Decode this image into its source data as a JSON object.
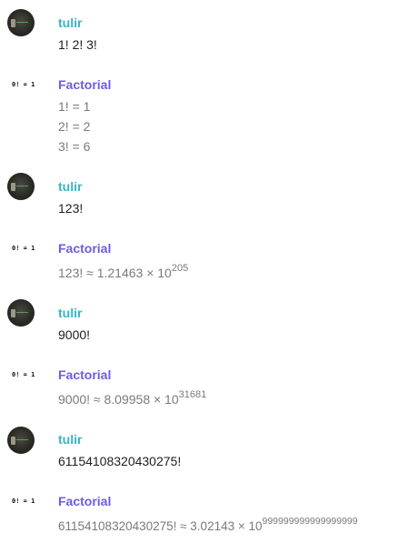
{
  "users": {
    "user": "tulir",
    "bot": "Factorial"
  },
  "bot_avatar_text": "0! = 1",
  "messages": [
    {
      "author": "tulir",
      "text": "1! 2! 3!"
    },
    {
      "author": "Factorial",
      "lines": [
        "1! = 1",
        "2! = 2",
        "3! = 6"
      ]
    },
    {
      "author": "tulir",
      "text": "123!"
    },
    {
      "author": "Factorial",
      "base": "123! ≈ 1.21463 × 10",
      "exp": "205"
    },
    {
      "author": "tulir",
      "text": "9000!"
    },
    {
      "author": "Factorial",
      "base": "9000! ≈ 8.09958 × 10",
      "exp": "31681"
    },
    {
      "author": "tulir",
      "text": "61154108320430275!"
    },
    {
      "author": "Factorial",
      "base": "61154108320430275! ≈ 3.02143 × 10",
      "exp": "999999999999999999"
    }
  ]
}
